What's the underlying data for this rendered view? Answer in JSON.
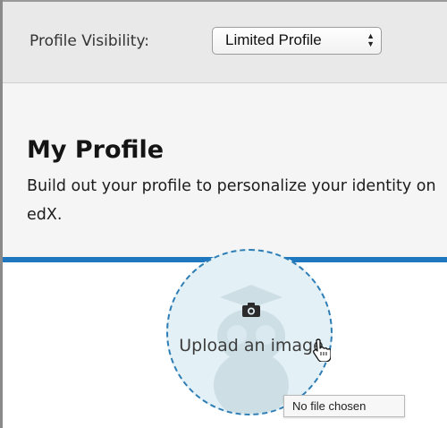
{
  "visibility": {
    "label": "Profile Visibility:",
    "selected": "Limited Profile",
    "arrows": "▲▼"
  },
  "profile": {
    "title": "My Profile",
    "subtitle": "Build out your profile to personalize your identity on edX."
  },
  "upload": {
    "label": "Upload an image",
    "tooltip": "No file chosen"
  },
  "colors": {
    "accent_blue": "#1f77bf",
    "upload_fill": "#e3f0f5",
    "dashed_border": "#2e7eb6"
  }
}
